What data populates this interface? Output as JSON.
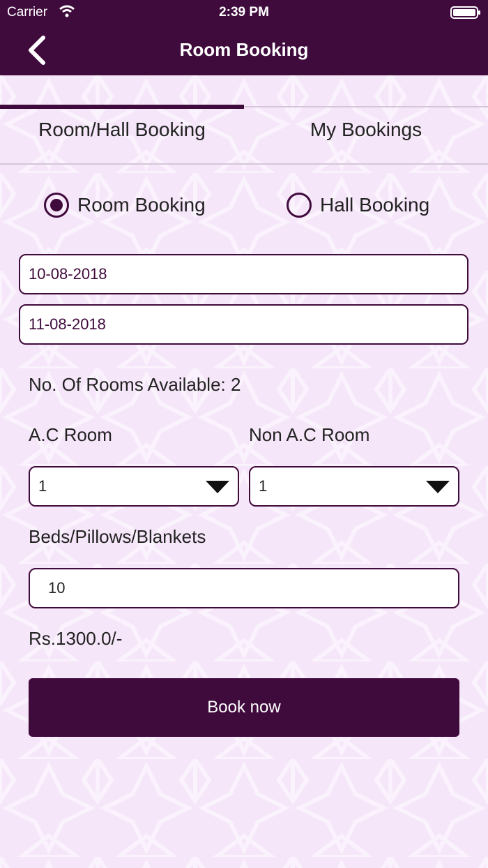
{
  "status_bar": {
    "carrier": "Carrier",
    "time": "2:39 PM"
  },
  "header": {
    "title": "Room Booking"
  },
  "tabs": [
    {
      "label": "Room/Hall Booking",
      "active": true
    },
    {
      "label": "My Bookings",
      "active": false
    }
  ],
  "booking_type": {
    "options": [
      {
        "label": "Room Booking",
        "selected": true
      },
      {
        "label": "Hall Booking",
        "selected": false
      }
    ]
  },
  "dates": {
    "check_in": "10-08-2018",
    "check_out": "11-08-2018"
  },
  "availability": {
    "text": "No. Of Rooms Available: 2"
  },
  "rooms": {
    "ac_label": "A.C Room",
    "ac_value": "1",
    "nonac_label": "Non A.C Room",
    "nonac_value": "1"
  },
  "extras": {
    "label": "Beds/Pillows/Blankets",
    "value": "10"
  },
  "price": {
    "text": "Rs.1300.0/-"
  },
  "actions": {
    "book_label": "Book now"
  },
  "colors": {
    "primary": "#3f0a3c",
    "background": "#f6e6f9"
  }
}
